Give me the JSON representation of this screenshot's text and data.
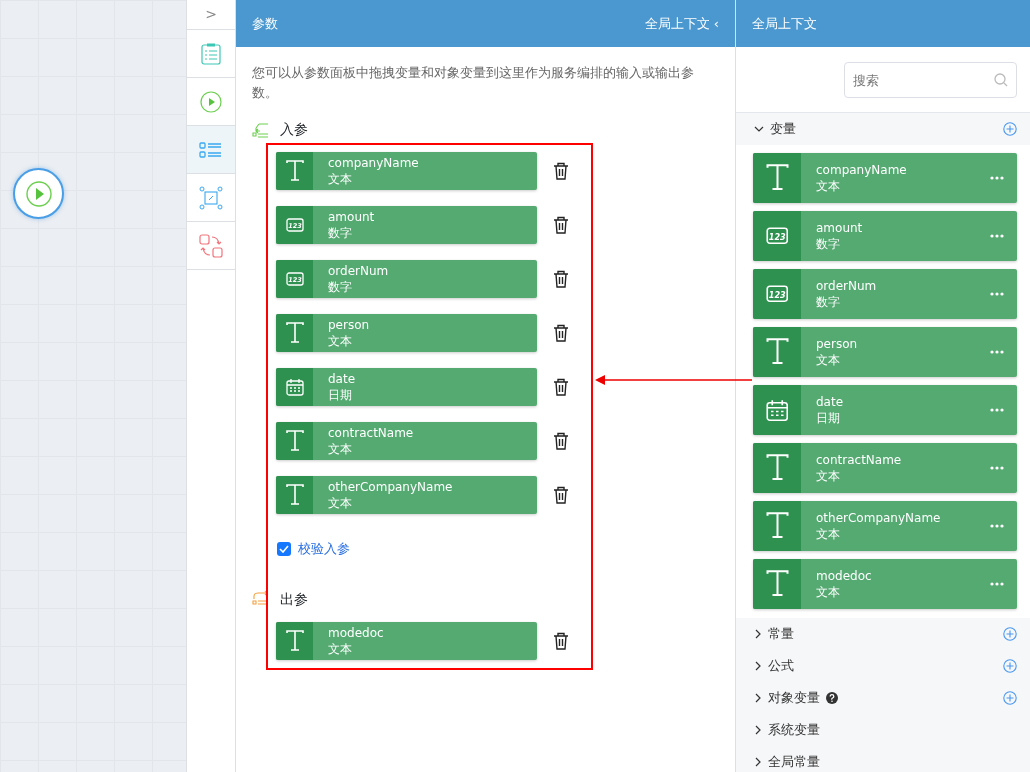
{
  "toolbar": {
    "collapse_label": ">",
    "items": [
      {
        "kind": "clipboard",
        "selected": false
      },
      {
        "kind": "play",
        "selected": false
      },
      {
        "kind": "list",
        "selected": true
      },
      {
        "kind": "nodes",
        "selected": false
      },
      {
        "kind": "swap",
        "selected": false
      }
    ]
  },
  "params_panel": {
    "title": "参数",
    "context_link": "全局上下文 ‹",
    "description": "您可以从参数面板中拖拽变量和对象变量到这里作为服务编排的输入或输出参数。",
    "input_section": {
      "title": "入参",
      "items": [
        {
          "name": "companyName",
          "type_label": "文本",
          "kind": "text"
        },
        {
          "name": "amount",
          "type_label": "数字",
          "kind": "number",
          "icon_label": "123"
        },
        {
          "name": "orderNum",
          "type_label": "数字",
          "kind": "number",
          "icon_label": "123"
        },
        {
          "name": "person",
          "type_label": "文本",
          "kind": "text"
        },
        {
          "name": "date",
          "type_label": "日期",
          "kind": "date"
        },
        {
          "name": "contractName",
          "type_label": "文本",
          "kind": "text"
        },
        {
          "name": "otherCompanyName",
          "type_label": "文本",
          "kind": "text"
        }
      ],
      "validate": {
        "label": "校验入参",
        "checked": true
      }
    },
    "output_section": {
      "title": "出参",
      "items": [
        {
          "name": "modedoc",
          "type_label": "文本",
          "kind": "text"
        }
      ]
    }
  },
  "context_panel": {
    "title": "全局上下文",
    "search": {
      "placeholder": "搜索"
    },
    "groups": [
      {
        "title": "变量",
        "expanded": true,
        "addable": true,
        "help": false,
        "items": [
          {
            "name": "companyName",
            "type_label": "文本",
            "kind": "text"
          },
          {
            "name": "amount",
            "type_label": "数字",
            "kind": "number",
            "icon_label": "123"
          },
          {
            "name": "orderNum",
            "type_label": "数字",
            "kind": "number",
            "icon_label": "123"
          },
          {
            "name": "person",
            "type_label": "文本",
            "kind": "text"
          },
          {
            "name": "date",
            "type_label": "日期",
            "kind": "date"
          },
          {
            "name": "contractName",
            "type_label": "文本",
            "kind": "text"
          },
          {
            "name": "otherCompanyName",
            "type_label": "文本",
            "kind": "text"
          },
          {
            "name": "modedoc",
            "type_label": "文本",
            "kind": "text"
          }
        ]
      },
      {
        "title": "常量",
        "expanded": false,
        "addable": true,
        "help": false
      },
      {
        "title": "公式",
        "expanded": false,
        "addable": true,
        "help": false
      },
      {
        "title": "对象变量",
        "expanded": false,
        "addable": true,
        "help": true
      },
      {
        "title": "系统变量",
        "expanded": false,
        "addable": false,
        "help": false
      },
      {
        "title": "全局常量",
        "expanded": false,
        "addable": false,
        "help": false
      }
    ]
  }
}
